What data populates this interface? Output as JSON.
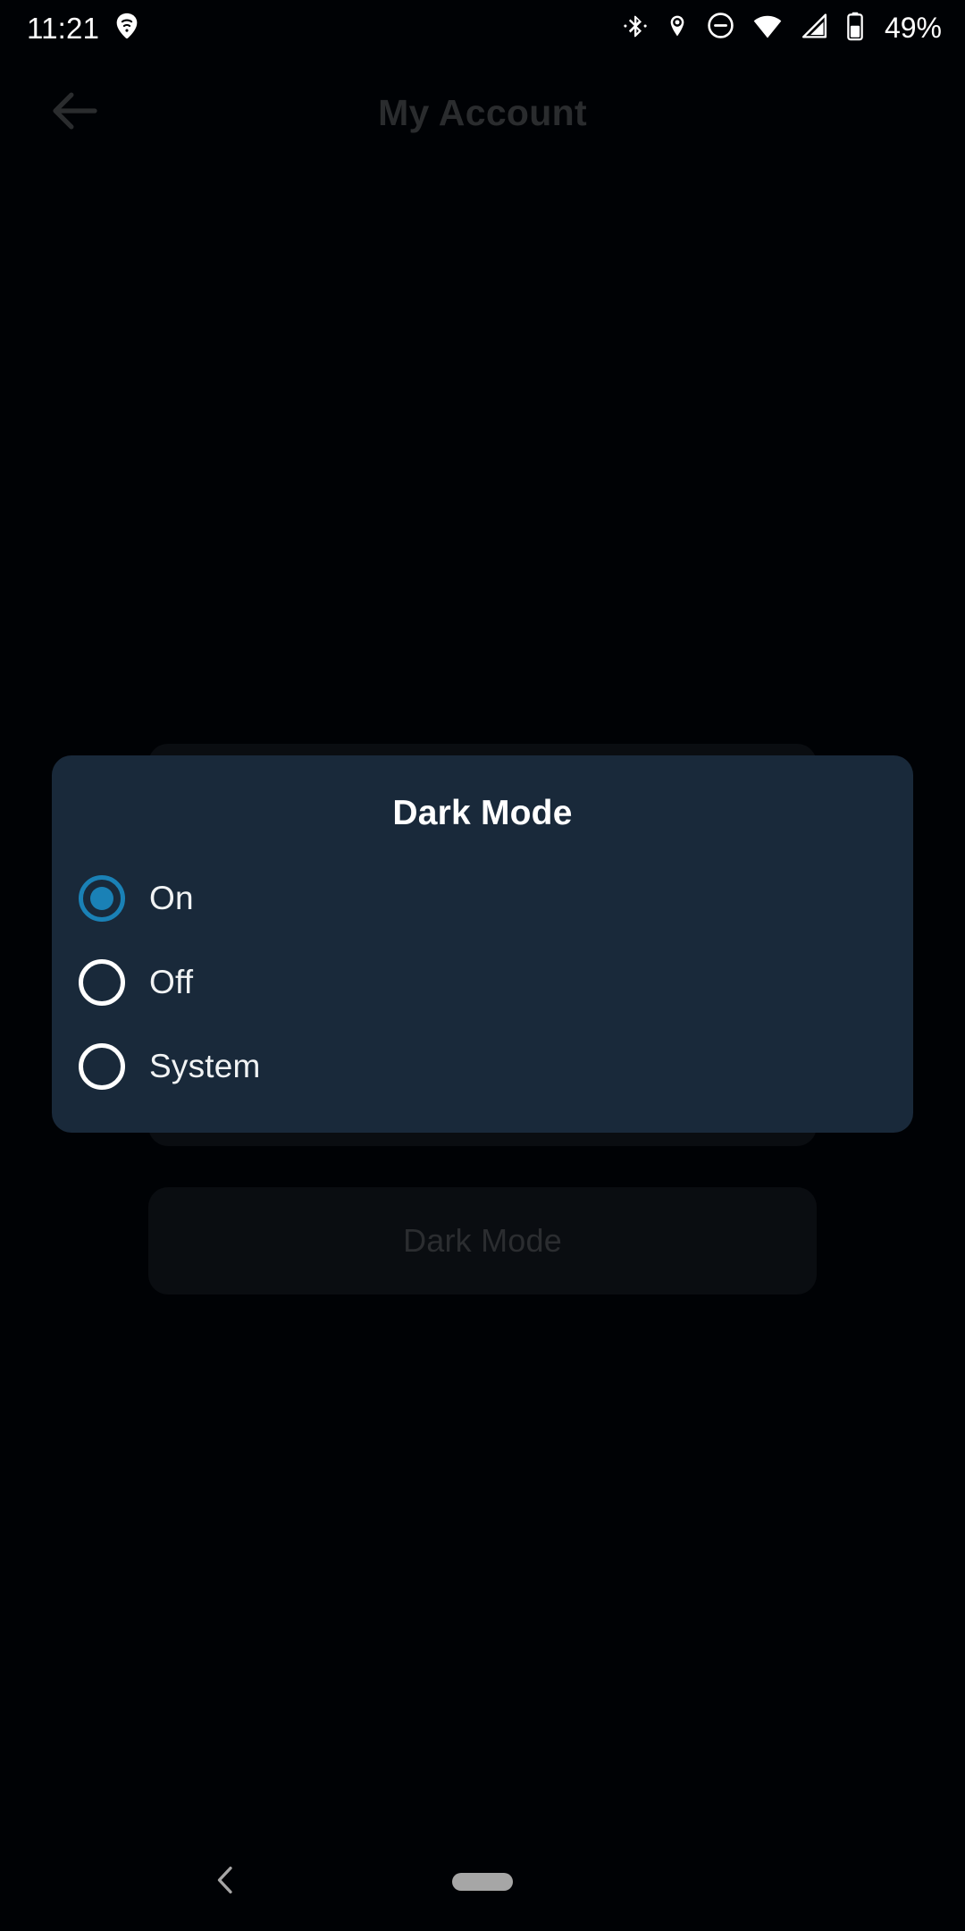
{
  "status_bar": {
    "time": "11:21",
    "battery_percent": "49%",
    "left_icons": [
      "wifi-calling-icon"
    ],
    "right_icons": [
      "bluetooth-icon",
      "location-pin-icon",
      "do-not-disturb-icon",
      "wifi-icon",
      "cellular-signal-icon",
      "battery-icon"
    ]
  },
  "app_bar": {
    "back_icon": "arrow-left-icon",
    "title": "My Account"
  },
  "background": {
    "card_label": "Dark Mode"
  },
  "dialog": {
    "title": "Dark Mode",
    "selected_value": "On",
    "options": [
      {
        "label": "On",
        "selected": true
      },
      {
        "label": "Off",
        "selected": false
      },
      {
        "label": "System",
        "selected": false
      }
    ]
  },
  "nav_bar": {
    "back_icon": "chevron-left-icon",
    "home_indicator": "home-pill-indicator"
  },
  "colors": {
    "screen_background": "#000205",
    "dialog_background": "#19293a",
    "accent": "#1a81b6",
    "primary_text": "#ffffff",
    "dimmed_text": "#2b2d30",
    "card_background": "#0a0d11"
  }
}
